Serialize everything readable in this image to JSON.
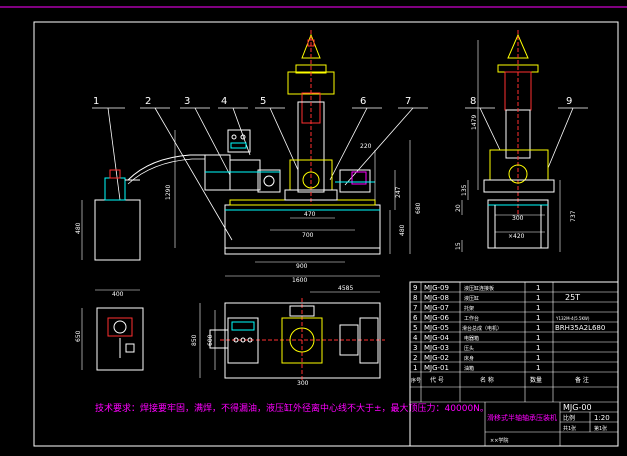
{
  "callouts": {
    "front": [
      "1",
      "2",
      "3",
      "4",
      "5",
      "6",
      "7"
    ],
    "side": [
      "8",
      "9"
    ]
  },
  "dims": {
    "front_height_left": "1290",
    "front_width_mid": "470",
    "front_width_700": "700",
    "front_width_900": "900",
    "front_width_1600": "1600",
    "front_220": "220",
    "front_247": "247",
    "front_480": "480",
    "front_680": "680",
    "tank_height": "480",
    "tank_width": "400",
    "side_height_top": "1479",
    "side_135": "135",
    "side_20": "20",
    "side_15": "15",
    "side_300": "300",
    "side_420": "×420",
    "side_737": "737",
    "plan_4585": "4585",
    "plan_850": "850",
    "plan_600": "600",
    "plan_300": "300",
    "tank_plan_650": "650"
  },
  "note": "技术要求：焊接要牢固，满焊，不得漏油，液压缸外径离中心线不大于±，最大顶压力：40000N。",
  "parts": [
    {
      "no": "9",
      "code": "MJG-09",
      "name": "液压缸连接板",
      "qty": "1",
      "remark": ""
    },
    {
      "no": "8",
      "code": "MJG-08",
      "name": "液压缸",
      "qty": "1",
      "remark": "25T"
    },
    {
      "no": "7",
      "code": "MJG-07",
      "name": "托架",
      "qty": "1",
      "remark": ""
    },
    {
      "no": "6",
      "code": "MJG-06",
      "name": "工作台",
      "qty": "1",
      "remark": "Y132M-4(5.5KW)"
    },
    {
      "no": "5",
      "code": "MJG-05",
      "name": "滑台总成（电机）",
      "qty": "1",
      "remark": "BRH35A2L680"
    },
    {
      "no": "4",
      "code": "MJG-04",
      "name": "电器箱",
      "qty": "1",
      "remark": ""
    },
    {
      "no": "3",
      "code": "MJG-03",
      "name": "压头",
      "qty": "1",
      "remark": ""
    },
    {
      "no": "2",
      "code": "MJG-02",
      "name": "床身",
      "qty": "1",
      "remark": ""
    },
    {
      "no": "1",
      "code": "MJG-01",
      "name": "油箱",
      "qty": "1",
      "remark": ""
    }
  ],
  "table_header": {
    "no": "序号",
    "code": "代  号",
    "name": "名  称",
    "qty": "数量",
    "remark": "备 注"
  },
  "title_block": {
    "title": "滑移式半轴轴承压装机",
    "drawing_no": "MJG-00",
    "scale_label": "比例",
    "scale": "1:20",
    "sheet": "共1张",
    "sheet2": "第1张",
    "school": "××学院"
  }
}
